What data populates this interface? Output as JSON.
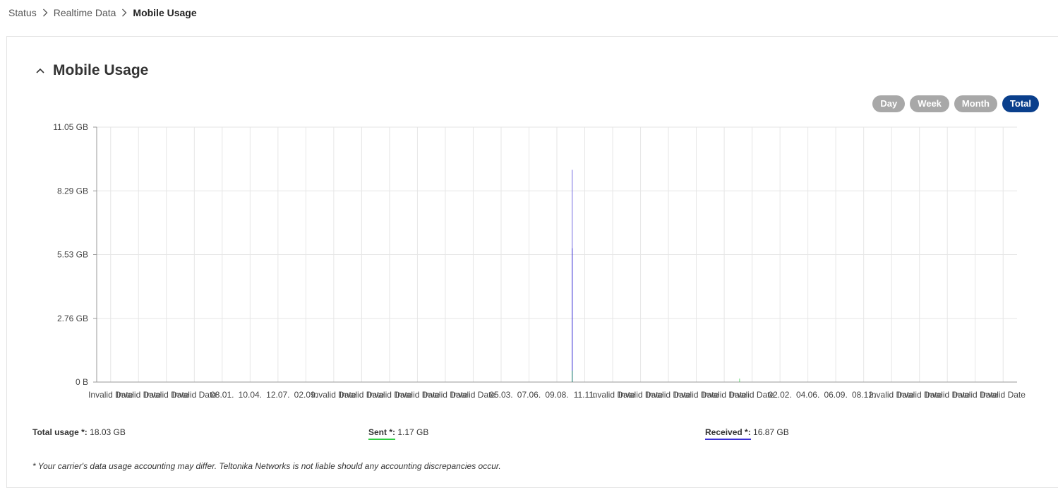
{
  "breadcrumb": {
    "items": [
      "Status",
      "Realtime Data",
      "Mobile Usage"
    ]
  },
  "section": {
    "title": "Mobile Usage"
  },
  "period_buttons": {
    "day": "Day",
    "week": "Week",
    "month": "Month",
    "total": "Total",
    "active": "Total"
  },
  "chart_data": {
    "type": "line",
    "y_ticks": [
      "11.05 GB",
      "8.29 GB",
      "5.53 GB",
      "2.76 GB",
      "0 B"
    ],
    "ylim_gb": [
      0,
      11.05
    ],
    "x_tick_labels": [
      "Invalid Date",
      "Invalid Date",
      "Invalid Date",
      "Invalid Date",
      "08.01.",
      "10.04.",
      "12.07.",
      "02.09.",
      "Invalid Date",
      "Invalid Date",
      "Invalid Date",
      "Invalid Date",
      "Invalid Date",
      "Invalid Date",
      "05.03.",
      "07.06.",
      "09.08.",
      "11.11.",
      "Invalid Date",
      "Invalid Date",
      "Invalid Date",
      "Invalid Date",
      "Invalid Date",
      "Invalid Date",
      "02.02.",
      "04.06.",
      "06.09.",
      "08.12.",
      "Invalid Date",
      "Invalid Date",
      "Invalid Date",
      "Invalid Date",
      "Invalid Date"
    ],
    "grid": true,
    "series": [
      {
        "name": "Received",
        "color": "#3a2fd4",
        "points": [
          {
            "x_tick_index": 17,
            "value_gb": 9.2
          },
          {
            "x_tick_index": 17,
            "value_gb": 5.8
          }
        ]
      },
      {
        "name": "Sent",
        "color": "#2ecc40",
        "points": [
          {
            "x_tick_index": 17,
            "value_gb": 0.5
          },
          {
            "x_tick_index": 23,
            "value_gb": 0.15
          }
        ]
      }
    ]
  },
  "stats": {
    "total_label": "Total usage *:",
    "total_value": "18.03 GB",
    "sent_label": "Sent *:",
    "sent_value": "1.17 GB",
    "received_label": "Received *:",
    "received_value": "16.87 GB",
    "colors": {
      "sent": "#2ecc40",
      "received": "#3a2fd4"
    }
  },
  "footnote": "* Your carrier's data usage accounting may differ. Teltonika Networks is not liable should any accounting discrepancies occur."
}
